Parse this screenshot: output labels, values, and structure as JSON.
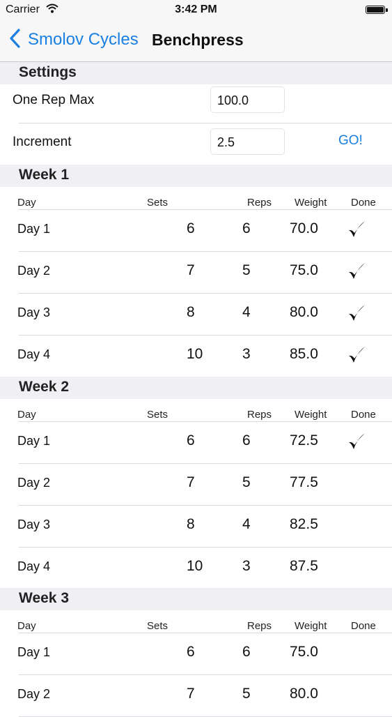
{
  "status": {
    "carrier": "Carrier",
    "time": "3:42 PM"
  },
  "nav": {
    "back_label": "Smolov Cycles",
    "title": "Benchpress"
  },
  "settings": {
    "header": "Settings",
    "one_rep_max_label": "One Rep Max",
    "one_rep_max_value": "100.0",
    "increment_label": "Increment",
    "increment_value": "2.5",
    "go_label": "GO!"
  },
  "columns": {
    "day": "Day",
    "sets": "Sets",
    "reps": "Reps",
    "weight": "Weight",
    "done": "Done"
  },
  "weeks": [
    {
      "title": "Week 1",
      "days": [
        {
          "day": "Day 1",
          "sets": "6",
          "reps": "6",
          "weight": "70.0",
          "done": true
        },
        {
          "day": "Day 2",
          "sets": "7",
          "reps": "5",
          "weight": "75.0",
          "done": true
        },
        {
          "day": "Day 3",
          "sets": "8",
          "reps": "4",
          "weight": "80.0",
          "done": true
        },
        {
          "day": "Day 4",
          "sets": "10",
          "reps": "3",
          "weight": "85.0",
          "done": true
        }
      ]
    },
    {
      "title": "Week 2",
      "days": [
        {
          "day": "Day 1",
          "sets": "6",
          "reps": "6",
          "weight": "72.5",
          "done": true
        },
        {
          "day": "Day 2",
          "sets": "7",
          "reps": "5",
          "weight": "77.5",
          "done": false
        },
        {
          "day": "Day 3",
          "sets": "8",
          "reps": "4",
          "weight": "82.5",
          "done": false
        },
        {
          "day": "Day 4",
          "sets": "10",
          "reps": "3",
          "weight": "87.5",
          "done": false
        }
      ]
    },
    {
      "title": "Week 3",
      "days": [
        {
          "day": "Day 1",
          "sets": "6",
          "reps": "6",
          "weight": "75.0",
          "done": false
        },
        {
          "day": "Day 2",
          "sets": "7",
          "reps": "5",
          "weight": "80.0",
          "done": false
        }
      ]
    }
  ]
}
